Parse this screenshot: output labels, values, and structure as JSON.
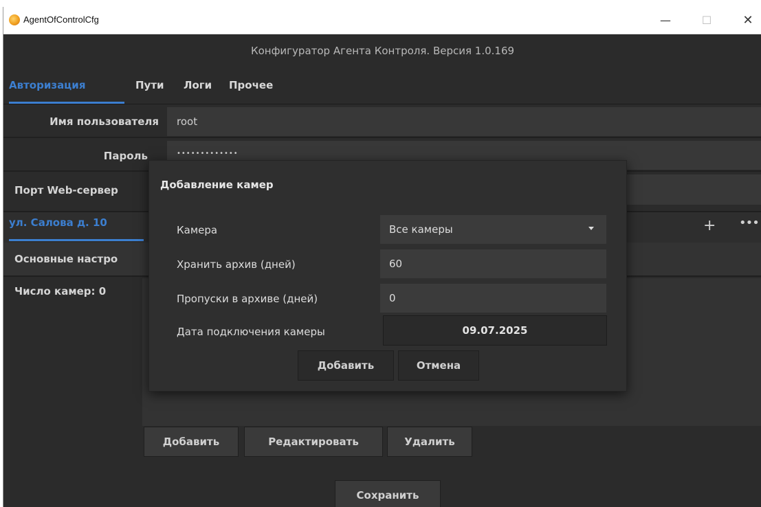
{
  "browser_strip": {
    "text_left": "(",
    "text_mid": "…",
    "text_link": "",
    "text_right": ")"
  },
  "window": {
    "title": "AgentOfControlCfg",
    "minimize": "—",
    "maximize": "☐",
    "close": "✕"
  },
  "header": {
    "title": "Конфигуратор Агента Контроля. Версия 1.0.169"
  },
  "tabs": [
    {
      "label": "Авторизация",
      "active": true
    },
    {
      "label": "Пути",
      "active": false
    },
    {
      "label": "Логи",
      "active": false
    },
    {
      "label": "Прочее",
      "active": false
    }
  ],
  "auth": {
    "username_label": "Имя пользователя",
    "username_value": "root",
    "password_label": "Пароль",
    "password_value": "•••••••••••••",
    "port_label": "Порт Web-сервер"
  },
  "group": {
    "name": "ул. Салова д. 10",
    "add_icon": "+",
    "more_icon": "•••"
  },
  "settings": {
    "tab_label": "Основные настро",
    "camera_count": "Число камер: 0"
  },
  "camera_buttons": {
    "add": "Добавить",
    "edit": "Редактировать",
    "delete": "Удалить"
  },
  "save_button": "Сохранить",
  "dialog": {
    "title": "Добавление камер",
    "camera_label": "Камера",
    "camera_value": "Все камеры",
    "archive_label": "Хранить архив (дней)",
    "archive_value": "60",
    "gaps_label": "Пропуски в архиве (дней)",
    "gaps_value": "0",
    "date_label": "Дата подключения камеры",
    "date_value": "09.07.2025",
    "add_button": "Добавить",
    "cancel_button": "Отмена"
  },
  "colors": {
    "accent": "#3c7fd0",
    "background": "#2b2b2b",
    "field": "#383838"
  }
}
